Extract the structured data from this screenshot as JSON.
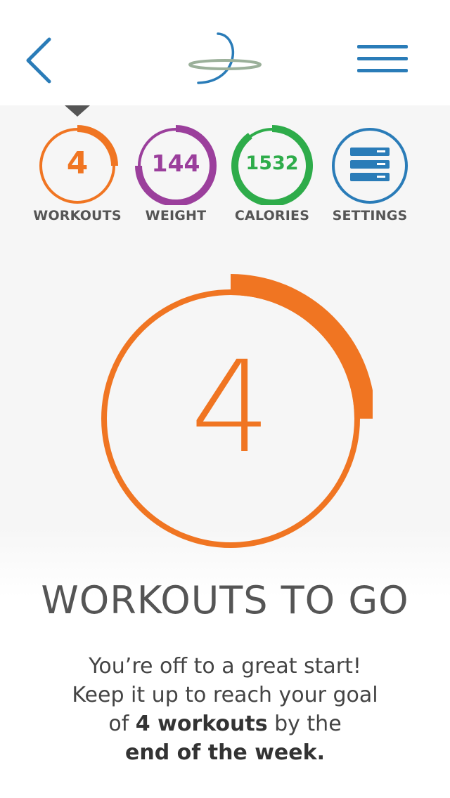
{
  "header": {
    "back_icon": "chevron-left-icon",
    "logo": "app-logo",
    "menu_icon": "hamburger-menu-icon"
  },
  "stats": [
    {
      "id": "workouts",
      "value": "4",
      "label": "WORKOUTS",
      "color": "#f07522",
      "progress": 0.25,
      "selected": true
    },
    {
      "id": "weight",
      "value": "144",
      "label": "WEIGHT",
      "color": "#9b3f9c",
      "progress": 0.75
    },
    {
      "id": "calories",
      "value": "1532",
      "label": "CALORIES",
      "color": "#2eac4a",
      "progress": 0.9
    },
    {
      "id": "settings",
      "value": "",
      "label": "SETTINGS",
      "color": "#2a7cb8",
      "icon": "server-settings-icon"
    }
  ],
  "main": {
    "count": "4",
    "progress": 0.25,
    "headline": "WORKOUTS TO GO",
    "message": {
      "line1": "You’re off to a great start!",
      "line2": "Keep it up to reach your goal",
      "line3_pre": "of ",
      "line3_bold": "4 workouts",
      "line3_post": " by the",
      "line4_bold": "end of the week."
    }
  },
  "colors": {
    "accent": "#f07522",
    "text": "#555555",
    "nav_blue": "#2a7cb8"
  }
}
